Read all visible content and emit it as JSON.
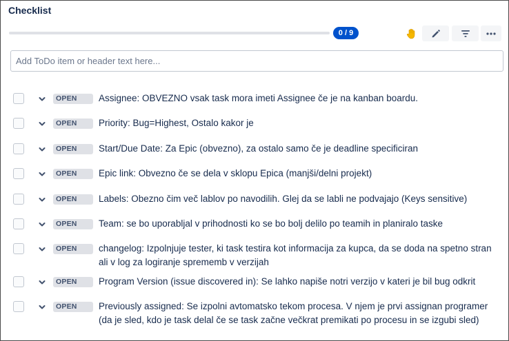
{
  "checklist": {
    "title": "Checklist",
    "progress_label": "0 / 9",
    "progress_fraction": 0,
    "accent_color": "#0052cc",
    "toolbar": {
      "hand_icon": "raised-hand-icon",
      "edit_icon": "pencil-icon",
      "filter_icon": "filter-icon",
      "more_icon": "more-dots-icon"
    },
    "add_input_placeholder": "Add ToDo item or header text here...",
    "items": [
      {
        "status": "OPEN",
        "text": "Assignee: OBVEZNO vsak task mora imeti Assignee če je na kanban boardu."
      },
      {
        "status": "OPEN",
        "text": "Priority: Bug=Highest, Ostalo kakor je"
      },
      {
        "status": "OPEN",
        "text": "Start/Due Date: Za Epic (obvezno), za ostalo samo če je deadline specificiran"
      },
      {
        "status": "OPEN",
        "text": "Epic link: Obvezno če se dela v sklopu Epica (manjši/delni projekt)"
      },
      {
        "status": "OPEN",
        "text": "Labels: Obezno čim več lablov po navodilih. Glej da se labli ne podvajajo (Keys sensitive)"
      },
      {
        "status": "OPEN",
        "text": "Team: se bo uporabljal v prihodnosti ko se bo bolj delilo po teamih in planiralo taske"
      },
      {
        "status": "OPEN",
        "text": "changelog: Izpolnjuje tester, ki task testira kot informacija za kupca, da se doda na spetno stran ali v log za logiranje sprememb v verzijah"
      },
      {
        "status": "OPEN",
        "text": "Program Version (issue discovered in): Se lahko napiše notri verzijo v kateri je bil bug odkrit"
      },
      {
        "status": "OPEN",
        "text": "Previously assigned: Se izpolni avtomatsko tekom procesa. V njem je prvi assignan programer (da je sled, kdo je task delal če se task začne večkrat premikati po procesu in se izgubi sled)"
      }
    ]
  }
}
